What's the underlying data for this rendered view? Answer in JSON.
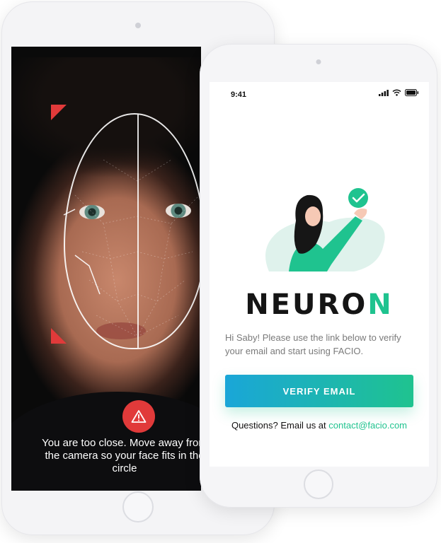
{
  "back_phone": {
    "warning_text": "You are too close. Move away from the camera so your face fits in the circle",
    "warning_icon": "warning-triangle-icon",
    "accent_color": "#e13a3a"
  },
  "front_phone": {
    "status": {
      "time": "9:41",
      "icons": [
        "signal-icon",
        "wifi-icon",
        "battery-icon"
      ]
    },
    "brand": {
      "prefix": "NEURO",
      "suffix": "N",
      "accent_color": "#1fc38f"
    },
    "message": "Hi Saby! Please use the link below to verify your email and start using FACIO.",
    "verify_button": {
      "label": "VERIFY EMAIL",
      "gradient": [
        "#1aa6d8",
        "#1fc38f"
      ]
    },
    "questions": {
      "prefix": "Questions? Email us at ",
      "email": "contact@facio.com"
    },
    "illustration_icon": "woman-check-illustration"
  }
}
